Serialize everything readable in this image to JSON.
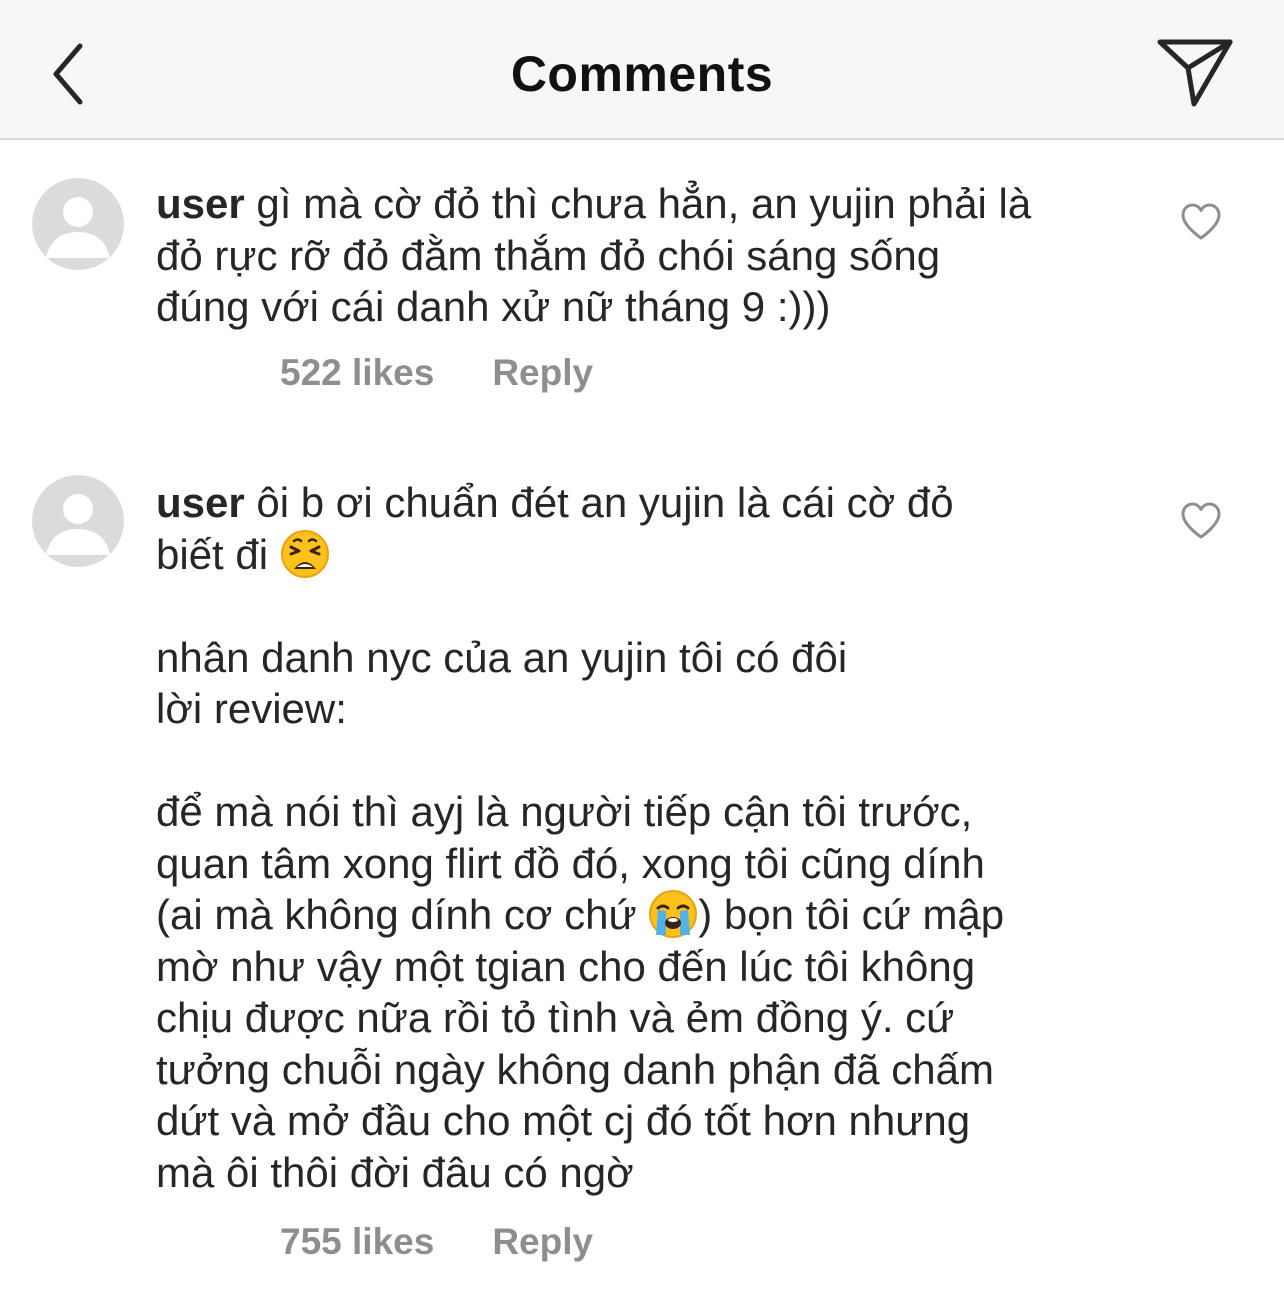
{
  "header": {
    "title": "Comments",
    "back_icon": "chevron-left-icon",
    "send_icon": "paper-plane-icon"
  },
  "comments": [
    {
      "username": "user",
      "text_parts": [
        "gì mà cờ đỏ thì chưa hẳn, an yujin phải là\nđỏ rực rỡ đỏ đằm thắm đỏ chói sáng sống\nđúng với cái danh xử nữ tháng 9 :)))"
      ],
      "likes": "522 likes",
      "reply": "Reply"
    },
    {
      "username": "user",
      "text_parts": [
        "ôi b ơi chuẩn đét an yujin là cái cờ đỏ\nbiết đi ",
        "\n\nnhân danh nyc của an yujin tôi có đôi\nlời review:\n\nđể mà nói thì ayj là người tiếp cận tôi trước,\nquan tâm xong flirt đồ đó, xong tôi cũng dính\n(ai mà không dính cơ chứ ",
        ") bọn tôi cứ mập\nmờ như vậy một tgian cho đến lúc tôi không\nchịu được nữa rồi tỏ tình và ẻm đồng ý. cứ\ntưởng chuỗi ngày không danh phận đã chấm\ndứt và mở đầu cho một cj đó tốt hơn nhưng\nmà ôi thôi đời đâu có ngờ"
      ],
      "emojis": [
        "weary-face-emoji",
        "loudly-crying-face-emoji"
      ],
      "likes": "755 likes",
      "reply": "Reply"
    }
  ],
  "colors": {
    "header_bg": "#f7f7f7",
    "text": "#262626",
    "meta": "#8e8e8e",
    "avatar_bg": "#dbdbdb"
  }
}
